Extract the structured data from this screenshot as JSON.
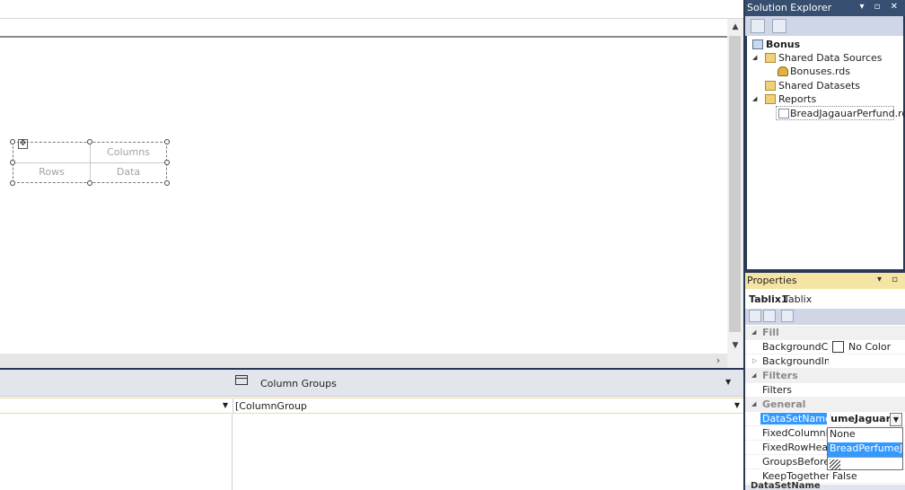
{
  "tablix": {
    "columns_label": "Columns",
    "rows_label": "Rows",
    "data_label": "Data"
  },
  "grouping": {
    "column_groups_title": "Column Groups",
    "column_group_value": "[ColumnGroup"
  },
  "solution_explorer": {
    "title": "Solution Explorer",
    "project": "Bonus",
    "items": [
      {
        "label": "Shared Data Sources",
        "icon": "folder-open-icon"
      },
      {
        "label": "Bonuses.rds",
        "icon": "data-source-icon"
      },
      {
        "label": "Shared Datasets",
        "icon": "folder-icon"
      },
      {
        "label": "Reports",
        "icon": "folder-open-icon"
      },
      {
        "label": "BreadJagauarPerfund.rdl",
        "icon": "report-file-icon"
      }
    ]
  },
  "properties": {
    "title": "Properties",
    "object_name": "Tablix1",
    "object_type": "Tablix",
    "categories": {
      "fill": "Fill",
      "filters": "Filters",
      "general": "General"
    },
    "rows": {
      "background_color": {
        "name": "BackgroundColor",
        "value": "No Color"
      },
      "background_image": {
        "name": "BackgroundImage",
        "value": ""
      },
      "filters": {
        "name": "Filters",
        "value": ""
      },
      "dataset_name": {
        "name": "DataSetName",
        "value": "PerfumeJaguar"
      },
      "fixed_column_headers": {
        "name": "FixedColumnHeaders",
        "value": ""
      },
      "fixed_row_headers": {
        "name": "FixedRowHeaders",
        "value": ""
      },
      "groups_before_row_headers": {
        "name": "GroupsBeforeRowHeaders",
        "value": ""
      },
      "keep_together": {
        "name": "KeepTogether",
        "value": "False"
      }
    },
    "dropdown_options": [
      "None",
      "BreadPerfumeJaguar"
    ],
    "status_text": "DataSetName"
  },
  "colors": {
    "panel_dark": "#293955",
    "selection": "#3399ff",
    "properties_title": "#f5e5a5"
  }
}
